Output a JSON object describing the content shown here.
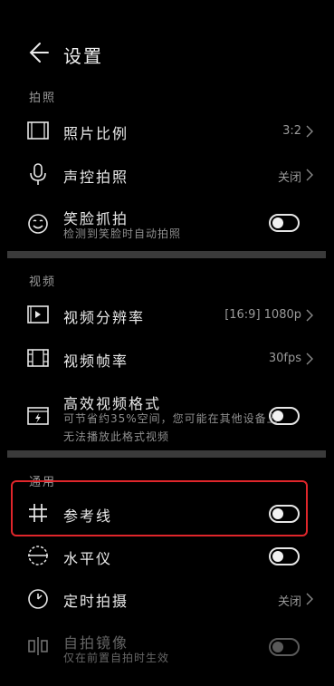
{
  "header": {
    "title": "设置"
  },
  "sections": {
    "photo": {
      "label": "拍照"
    },
    "video": {
      "label": "视频"
    },
    "general": {
      "label": "通用"
    }
  },
  "photo": {
    "ratio": {
      "label": "照片比例",
      "value": "3:2"
    },
    "voice": {
      "label": "声控拍照",
      "value": "关闭"
    },
    "smile": {
      "label": "笑脸抓拍",
      "sub": "检测到笑脸时自动拍照",
      "toggle": false
    }
  },
  "video": {
    "resolution": {
      "label": "视频分辨率",
      "value": "[16:9] 1080p"
    },
    "framerate": {
      "label": "视频帧率",
      "value": "30fps"
    },
    "format": {
      "label": "高效视频格式",
      "sub": "可节省约35%空间，您可能在其他设备上无法播放此格式视频",
      "toggle": false
    }
  },
  "general": {
    "grid": {
      "label": "参考线",
      "toggle": false
    },
    "level": {
      "label": "水平仪",
      "toggle": false
    },
    "timer": {
      "label": "定时拍摄",
      "value": "关闭"
    },
    "mirror": {
      "label": "自拍镜像",
      "sub": "仅在前置自拍时生效",
      "toggle": false,
      "disabled": true
    }
  },
  "icons": [
    "back-arrow-icon",
    "aspect-ratio-icon",
    "microphone-icon",
    "smile-icon",
    "video-resolution-icon",
    "film-icon",
    "video-format-icon",
    "grid-hash-icon",
    "level-icon",
    "timer-icon",
    "mirror-icon",
    "chevron-right-icon"
  ],
  "colors": {
    "background": "#000000",
    "text": "#e6e6e6",
    "muted": "#9a9a9a",
    "divider": "#3a3a3a",
    "highlight": "#e0262b"
  }
}
